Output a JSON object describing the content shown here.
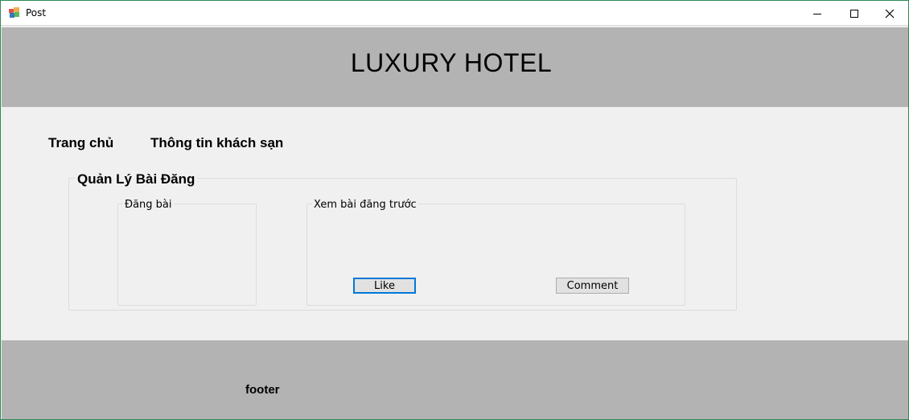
{
  "window": {
    "title": "Post",
    "icons": {
      "app": "winforms-app-icon",
      "minimize": "minimize-icon",
      "maximize": "maximize-icon",
      "close": "close-icon"
    }
  },
  "header": {
    "title": "LUXURY HOTEL"
  },
  "nav": {
    "home": "Trang chủ",
    "info": "Thông tin khách sạn"
  },
  "manage": {
    "title": "Quản Lý Bài Đăng",
    "post_group": {
      "title": "Đăng bài"
    },
    "view_group": {
      "title": "Xem bài đăng trước",
      "like_label": "Like",
      "comment_label": "Comment"
    }
  },
  "footer": {
    "text": "footer"
  },
  "colors": {
    "band": "#b3b3b3",
    "client_bg": "#f0f0f0",
    "focus_border": "#0078d7",
    "window_border": "#2e8b57"
  }
}
